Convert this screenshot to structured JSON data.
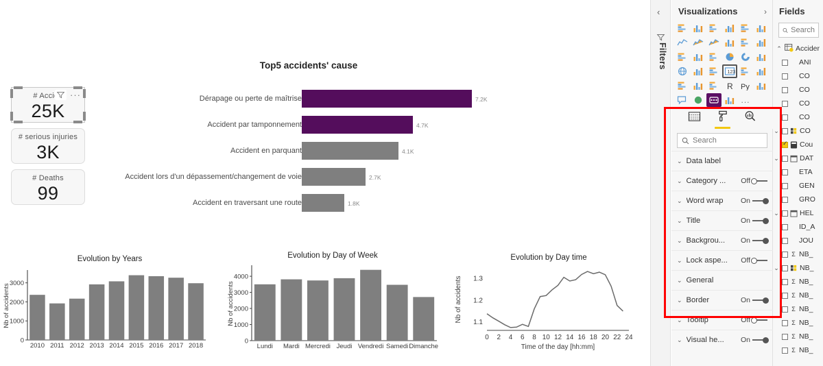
{
  "kpis": [
    {
      "title": "# Accide",
      "value": "25K",
      "selected": true,
      "filter_icon": "filter-icon",
      "more_icon": "more-options-icon"
    },
    {
      "title": "# serious injuries",
      "value": "3K",
      "selected": false
    },
    {
      "title": "# Deaths",
      "value": "99",
      "selected": false
    }
  ],
  "top5": {
    "title": "Top5 accidents' cause",
    "categories": [
      "Dérapage ou perte de maîtrise",
      "Accident par tamponnement",
      "Accident en parquant",
      "Accident lors d'un dépassement/changement de voie",
      "Accident en traversant une route"
    ],
    "labels": [
      "7.2K",
      "4.7K",
      "4.1K",
      "2.7K",
      "1.8K"
    ],
    "values": [
      7200,
      4700,
      4100,
      2700,
      1800
    ],
    "colors": [
      "#540d5c",
      "#540d5c",
      "#7f7f7f",
      "#7f7f7f",
      "#7f7f7f"
    ]
  },
  "chart_data": [
    {
      "type": "bar",
      "title": "Evolution by Years",
      "xlabel": "",
      "ylabel": "Nb of accidents",
      "categories": [
        "2010",
        "2011",
        "2012",
        "2013",
        "2014",
        "2015",
        "2016",
        "2017",
        "2018"
      ],
      "values": [
        2370,
        1920,
        2170,
        2920,
        3080,
        3400,
        3350,
        3270,
        2980
      ],
      "yticks": [
        0,
        1000,
        2000,
        3000
      ],
      "ylim": [
        0,
        3600
      ],
      "color": "#7f7f7f",
      "grid": false,
      "legend": "none"
    },
    {
      "type": "bar",
      "title": "Evolution by Day of Week",
      "xlabel": "",
      "ylabel": "Nb of accidents",
      "categories": [
        "Lundi",
        "Mardi",
        "Mercredi",
        "Jeudi",
        "Vendredi",
        "Samedi",
        "Dimanche"
      ],
      "values": [
        3500,
        3810,
        3740,
        3880,
        4400,
        3470,
        2710
      ],
      "yticks": [
        0,
        1000,
        2000,
        3000,
        4000
      ],
      "ylim": [
        0,
        4600
      ],
      "color": "#7f7f7f",
      "grid": false,
      "legend": "none"
    },
    {
      "type": "line",
      "title": "Evolution by Day time",
      "xlabel": "Time of the day  [hh:mm]",
      "ylabel": "Nb of accidents",
      "x": [
        0,
        1,
        2,
        3,
        4,
        5,
        6,
        7,
        8,
        9,
        10,
        11,
        12,
        13,
        14,
        15,
        16,
        17,
        18,
        19,
        20,
        21,
        22,
        23
      ],
      "values": [
        1.137,
        1.118,
        1.102,
        1.086,
        1.073,
        1.075,
        1.088,
        1.078,
        1.159,
        1.216,
        1.221,
        1.247,
        1.268,
        1.305,
        1.288,
        1.294,
        1.318,
        1.332,
        1.322,
        1.329,
        1.317,
        1.264,
        1.175,
        1.149
      ],
      "xticks": [
        0,
        2,
        4,
        6,
        8,
        10,
        12,
        14,
        16,
        18,
        20,
        22,
        24
      ],
      "yticks": [
        1.1,
        1.2,
        1.3
      ],
      "xlim": [
        0,
        24
      ],
      "ylim": [
        1.06,
        1.345
      ],
      "color": "#6b6b6b",
      "grid": false,
      "legend": "none"
    },
    {
      "type": "bar",
      "title": "Top5 accidents' cause",
      "orientation": "horizontal",
      "categories": [
        "Dérapage ou perte de maîtrise",
        "Accident par tamponnement",
        "Accident en parquant",
        "Accident lors d'un dépassement/changement de voie",
        "Accident en traversant une route"
      ],
      "values": [
        7200,
        4700,
        4100,
        2700,
        1800
      ],
      "data_labels": [
        "7.2K",
        "4.7K",
        "4.1K",
        "2.7K",
        "1.8K"
      ],
      "xlabel": "",
      "ylabel": "",
      "grid": false,
      "legend": "none"
    }
  ],
  "filters_rail": {
    "collapse_icon": "chevron-left-icon",
    "filter_icon": "filter-icon",
    "label": "Filters"
  },
  "visualizations": {
    "title": "Visualizations",
    "expand_icon": "chevron-right-icon",
    "icons": [
      "stacked-bar-chart-icon",
      "stacked-column-chart-icon",
      "clustered-bar-chart-icon",
      "clustered-column-chart-icon",
      "100-stacked-bar-chart-icon",
      "100-stacked-column-chart-icon",
      "line-chart-icon",
      "area-chart-icon",
      "stacked-area-chart-icon",
      "line-stacked-column-icon",
      "line-clustered-column-icon",
      "ribbon-chart-icon",
      "waterfall-chart-icon",
      "funnel-chart-icon",
      "scatter-chart-icon",
      "pie-chart-icon",
      "donut-chart-icon",
      "treemap-icon",
      "map-icon",
      "filled-map-icon",
      "gauge-icon",
      "card-icon",
      "multi-row-card-icon",
      "kpi-icon",
      "slicer-icon",
      "table-icon",
      "matrix-icon",
      "r-visual-icon",
      "python-visual-icon",
      "key-influencers-icon",
      "qa-visual-icon",
      "arcgis-map-icon",
      "custom-visual-icon",
      "more-visuals-icon"
    ],
    "selected_icon_index": 21,
    "purple_icon_index": 32,
    "more_label": "..."
  },
  "format_pane": {
    "tabs": [
      {
        "name": "fields-tab",
        "icon": "fields-table-icon",
        "active": false
      },
      {
        "name": "format-tab",
        "icon": "paint-roller-icon",
        "active": true
      },
      {
        "name": "analytics-tab",
        "icon": "analytics-magnifier-icon",
        "active": false
      }
    ],
    "search": {
      "placeholder": "Search",
      "icon": "search-icon"
    },
    "sections": [
      {
        "label": "Data label",
        "toggle": null
      },
      {
        "label": "Category ...",
        "toggle": "Off"
      },
      {
        "label": "Word wrap",
        "toggle": "On"
      },
      {
        "label": "Title",
        "toggle": "On"
      },
      {
        "label": "Backgrou...",
        "toggle": "On"
      },
      {
        "label": "Lock aspe...",
        "toggle": "Off"
      },
      {
        "label": "General",
        "toggle": null
      },
      {
        "label": "Border",
        "toggle": "On"
      },
      {
        "label": "Tooltip",
        "toggle": "Off"
      },
      {
        "label": "Visual he...",
        "toggle": "On"
      }
    ],
    "highlight_color": "#ff0000"
  },
  "fields": {
    "title": "Fields",
    "search": {
      "placeholder": "Search",
      "icon": "search-icon"
    },
    "table": {
      "label": "Accider",
      "icon": "table-icon",
      "expanded": true
    },
    "items": [
      {
        "label": "ANI",
        "checked": false,
        "icon": null,
        "expandable": false
      },
      {
        "label": "CO",
        "checked": false,
        "icon": null,
        "expandable": false
      },
      {
        "label": "CO",
        "checked": false,
        "icon": null,
        "expandable": false
      },
      {
        "label": "CO",
        "checked": false,
        "icon": null,
        "expandable": false
      },
      {
        "label": "CO",
        "checked": false,
        "icon": null,
        "expandable": false
      },
      {
        "label": "CO",
        "checked": false,
        "icon": "hierarchy-icon",
        "expandable": true
      },
      {
        "label": "Cou",
        "checked": true,
        "icon": "measure-icon",
        "expandable": false
      },
      {
        "label": "DAT",
        "checked": false,
        "icon": "date-icon",
        "expandable": true
      },
      {
        "label": "ETA",
        "checked": false,
        "icon": null,
        "expandable": false
      },
      {
        "label": "GEN",
        "checked": false,
        "icon": null,
        "expandable": false
      },
      {
        "label": "GRO",
        "checked": false,
        "icon": null,
        "expandable": false
      },
      {
        "label": "HEL",
        "checked": false,
        "icon": "date-icon",
        "expandable": true
      },
      {
        "label": "ID_A",
        "checked": false,
        "icon": null,
        "expandable": false
      },
      {
        "label": "JOU",
        "checked": false,
        "icon": null,
        "expandable": false
      },
      {
        "label": "NB_",
        "checked": false,
        "icon": "sigma-icon",
        "expandable": false
      },
      {
        "label": "NB_",
        "checked": false,
        "icon": "hierarchy-icon",
        "expandable": true
      },
      {
        "label": "NB_",
        "checked": false,
        "icon": "sigma-icon",
        "expandable": false
      },
      {
        "label": "NB_",
        "checked": false,
        "icon": "sigma-icon",
        "expandable": false
      },
      {
        "label": "NB_",
        "checked": false,
        "icon": "sigma-icon",
        "expandable": false
      },
      {
        "label": "NB_",
        "checked": false,
        "icon": "sigma-icon",
        "expandable": false
      },
      {
        "label": "NB_",
        "checked": false,
        "icon": "sigma-icon",
        "expandable": false
      },
      {
        "label": "NB_",
        "checked": false,
        "icon": "sigma-icon",
        "expandable": false
      }
    ]
  }
}
